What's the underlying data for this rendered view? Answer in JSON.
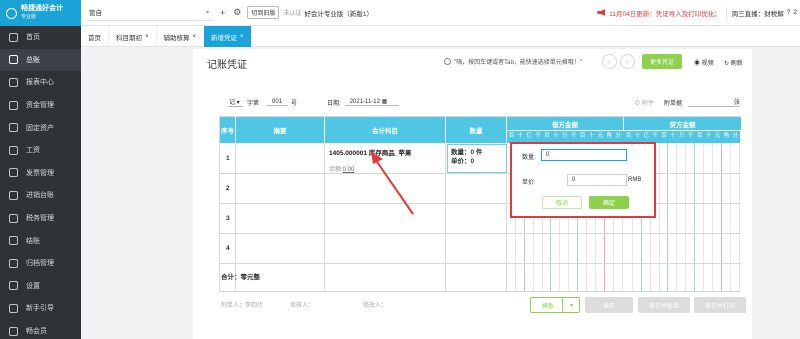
{
  "sidebar": {
    "logo_title": "畅捷通好会计",
    "logo_sub": "专业版",
    "items": [
      {
        "label": "首页",
        "active": false
      },
      {
        "label": "总账",
        "active": true
      },
      {
        "label": "报表中心",
        "active": false
      },
      {
        "label": "资金管理",
        "active": false
      },
      {
        "label": "固定资产",
        "active": false
      },
      {
        "label": "工资",
        "active": false
      },
      {
        "label": "发票管理",
        "active": false
      },
      {
        "label": "进销台账",
        "active": false
      },
      {
        "label": "税务管理",
        "active": false
      },
      {
        "label": "结账",
        "active": false
      },
      {
        "label": "归档管理",
        "active": false
      },
      {
        "label": "设置",
        "active": false
      },
      {
        "label": "新手引导",
        "active": false
      },
      {
        "label": "畅会员",
        "active": false
      }
    ]
  },
  "topbar": {
    "account": "管自",
    "switch_btn": "切到旧版",
    "cert": "未认证",
    "version": "好会计专业版（新版1）",
    "news": "11月04日更新：凭证导入及打印优化；",
    "live": "周三直播：财税解",
    "right": "2"
  },
  "tabs": [
    {
      "label": "首页",
      "closable": false,
      "active": false
    },
    {
      "label": "科目期初",
      "closable": true,
      "active": false
    },
    {
      "label": "辅助核算",
      "closable": true,
      "active": false
    },
    {
      "label": "新增凭证",
      "closable": true,
      "active": true
    }
  ],
  "page": {
    "title": "记账凭证",
    "hint": "\"嗨，按回车键或者Tab，能快速选择单元格哦！\"",
    "more_btn": "更多凭证",
    "video": "视频",
    "refresh": "刷新"
  },
  "voucher": {
    "type": "记",
    "num_label": "字第",
    "num": "001",
    "num_suffix": "号",
    "date_label": "日期:",
    "date": "2021-11-12",
    "attach": "附件",
    "count_label": "附单据",
    "count_suffix": "张"
  },
  "grid": {
    "headers": {
      "seq": "序号",
      "summary": "摘要",
      "account": "会计科目",
      "qty": "数量",
      "debit": "借方金额",
      "credit": "贷方金额"
    },
    "digits": [
      "百",
      "十",
      "亿",
      "千",
      "百",
      "十",
      "万",
      "千",
      "百",
      "十",
      "元",
      "角",
      "分"
    ],
    "rows": [
      "1",
      "2",
      "3",
      "4"
    ],
    "account_text": "1405.000001 库存商品_苹果",
    "balance_label": "余额:",
    "balance_value": "0.00",
    "qty_line": "数量：0 件",
    "price_line": "单价：0",
    "total": "合计：零元整"
  },
  "footer": {
    "maker": "制单人：",
    "maker_name": "李四代",
    "reviewer": "审核人：",
    "modifier": "修改人：",
    "template": "模板",
    "save": "保存",
    "save_new": "保存并新增",
    "save_print": "保存并打印"
  },
  "popup": {
    "qty_label": "数量:",
    "qty_value": "0",
    "price_label": "单价:",
    "price_value": "0",
    "unit": "RMB",
    "cancel": "取消",
    "ok": "确定"
  }
}
